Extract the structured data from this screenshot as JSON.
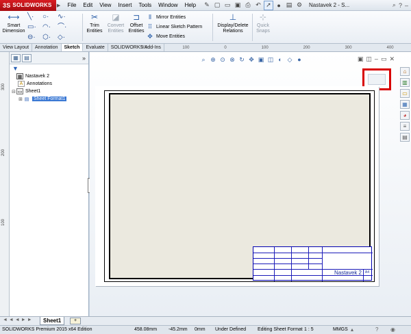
{
  "app": {
    "logo": "SOLIDWORKS",
    "doc_title": "Nastavek 2 - S..."
  },
  "menu": [
    "File",
    "Edit",
    "View",
    "Insert",
    "Tools",
    "Window",
    "Help"
  ],
  "commands": {
    "smart_dimension": "Smart\nDimension",
    "trim": "Trim\nEntities",
    "convert": "Convert\nEntities",
    "offset": "Offset\nEntities",
    "mirror": "Mirror Entities",
    "linear_pattern": "Linear Sketch Pattern",
    "move": "Move Entities",
    "display_delete": "Display/Delete\nRelations",
    "quick_snaps": "Quick\nSnaps"
  },
  "tabs": [
    "View Layout",
    "Annotation",
    "Sketch",
    "Evaluate",
    "SOLIDWORKS Add-Ins"
  ],
  "active_tab": "Sketch",
  "ruler_top": [
    "200",
    "100",
    "0",
    "100",
    "200",
    "300",
    "400"
  ],
  "ruler_left": [
    "300",
    "200",
    "100"
  ],
  "tree": {
    "root": "Nastavek 2",
    "annotations": "Annotations",
    "sheet": "Sheet1",
    "sheet_format": "Sheet Format1"
  },
  "title_block": {
    "part_name": "Nastavek 2",
    "sheet": "A4"
  },
  "sheet_tab": "Sheet1",
  "status": {
    "edition": "SOLIDWORKS Premium 2015 x64 Edition",
    "x": "458.08mm",
    "y": "-45.2mm",
    "z": "0mm",
    "defined": "Under Defined",
    "editing": "Editing Sheet Format",
    "scale": "1 : 5",
    "units": "MMGS"
  },
  "colors": {
    "accent": "#3b79d4",
    "highlight_box": "#d80000",
    "title_block_lines": "#1a1ab8"
  }
}
